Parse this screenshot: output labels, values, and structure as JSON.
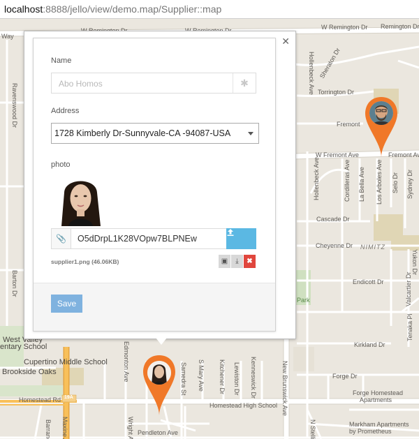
{
  "browser": {
    "url_host": "localhost",
    "url_path": ":8888/jello/view/demo.map/Supplier::map"
  },
  "map": {
    "street_labels": [
      "W Remington Dr",
      "W Remington Dr",
      "W Remington Dr",
      "Remington Dr",
      "Sheraton Dr",
      "Torrington Dr",
      "Fremont",
      "W Fremont Ave",
      "Fremont Ave",
      "Cascade Dr",
      "Cheyenne Dr",
      "Endicott Dr",
      "Kirkland Dr",
      "Forge Dr",
      "Homestead Rd",
      "Homestead High School",
      "Pendleton Ave",
      "Cupertino Middle School",
      "Brookside Oaks",
      "Markham Apartments",
      "by Prometheus",
      "Forge Homestead",
      "Apartments"
    ],
    "vertical_labels": [
      "Ravenswood Dr",
      "Hollenbeck Ave",
      "Cordilleras Ave",
      "La Bella Ave",
      "Los Arboles Ave",
      "Selo Dr",
      "Sydney Dr",
      "Valcartier Dr",
      "Yukon Dr",
      "Tenaka Pl",
      "Barton Dr",
      "Edmonton Ave",
      "Samedra St",
      "S Mary Ave",
      "Kitchener Dr",
      "Lewiston Dr",
      "Kenneswick Dr",
      "New Brunswick Ave",
      "Wright Ave",
      "Maxine Ave",
      "Barranca Dr",
      "N Stelling Rd"
    ],
    "region_label": "NIMITZ",
    "park_label": "Park",
    "highway_badge": "19A",
    "partial_labels": [
      "West Valley",
      "entary School",
      "Way",
      "Ave",
      "Ave"
    ]
  },
  "popup": {
    "close_icon": "close-icon",
    "name_label": "Name",
    "name_placeholder": "Abo Homos",
    "address_label": "Address",
    "address_value": "1728 Kimberly Dr-Sunnyvale-CA -94087-USA",
    "photo_label": "photo",
    "file_token": "O5dDrpL1K28VOpw7BLPNEw",
    "file_info": "supplier1.png (46.06KB)",
    "save_label": "Save"
  },
  "colors": {
    "pin": "#f07828",
    "upload_button": "#5bb8e3",
    "save_button": "#7fb2df",
    "delete_button": "#e0463d",
    "highway": "#f4a535"
  }
}
